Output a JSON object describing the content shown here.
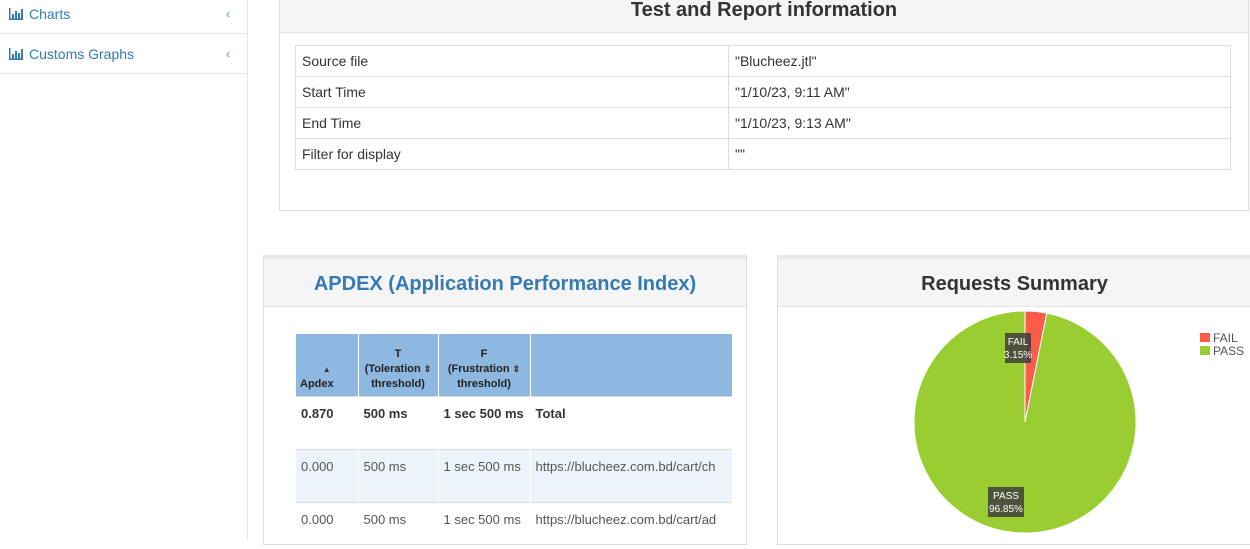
{
  "sidebar": {
    "items": [
      {
        "label": "Charts",
        "icon": "bar-chart-icon"
      },
      {
        "label": "Customs Graphs",
        "icon": "bar-chart-icon"
      }
    ]
  },
  "report_info": {
    "title": "Test and Report information",
    "rows": [
      {
        "key": "Source file",
        "value": "\"Blucheez.jtl\""
      },
      {
        "key": "Start Time",
        "value": "\"1/10/23, 9:11 AM\""
      },
      {
        "key": "End Time",
        "value": "\"1/10/23, 9:13 AM\""
      },
      {
        "key": "Filter for display",
        "value": "\"\""
      }
    ]
  },
  "apdex": {
    "title": "APDEX (Application Performance Index)",
    "headers": {
      "apdex": "Apdex",
      "t_line1": "T",
      "t_line2": "(Toleration",
      "t_line3": "threshold)",
      "f_line1": "F",
      "f_line2": "(Frustration",
      "f_line3": "threshold)",
      "label": ""
    },
    "rows": [
      {
        "apdex": "0.870",
        "t": "500 ms",
        "f": "1 sec 500 ms",
        "label": "Total"
      },
      {
        "apdex": "0.000",
        "t": "500 ms",
        "f": "1 sec 500 ms",
        "label": "https://blucheez.com.bd/cart/ch"
      },
      {
        "apdex": "0.000",
        "t": "500 ms",
        "f": "1 sec 500 ms",
        "label": "https://blucheez.com.bd/cart/ad"
      }
    ]
  },
  "requests_summary": {
    "title": "Requests Summary",
    "colors": {
      "fail": "#ff5b4a",
      "pass": "#9acd32"
    },
    "legend": [
      {
        "label": "FAIL",
        "color": "#ff5b4a"
      },
      {
        "label": "PASS",
        "color": "#9acd32"
      }
    ]
  },
  "chart_data": {
    "type": "pie",
    "title": "Requests Summary",
    "slices": [
      {
        "label": "FAIL",
        "value": 3.15,
        "display": "3.15%",
        "color": "#ff5b4a"
      },
      {
        "label": "PASS",
        "value": 96.85,
        "display": "96.85%",
        "color": "#9acd32"
      }
    ],
    "legend_position": "top-right"
  }
}
